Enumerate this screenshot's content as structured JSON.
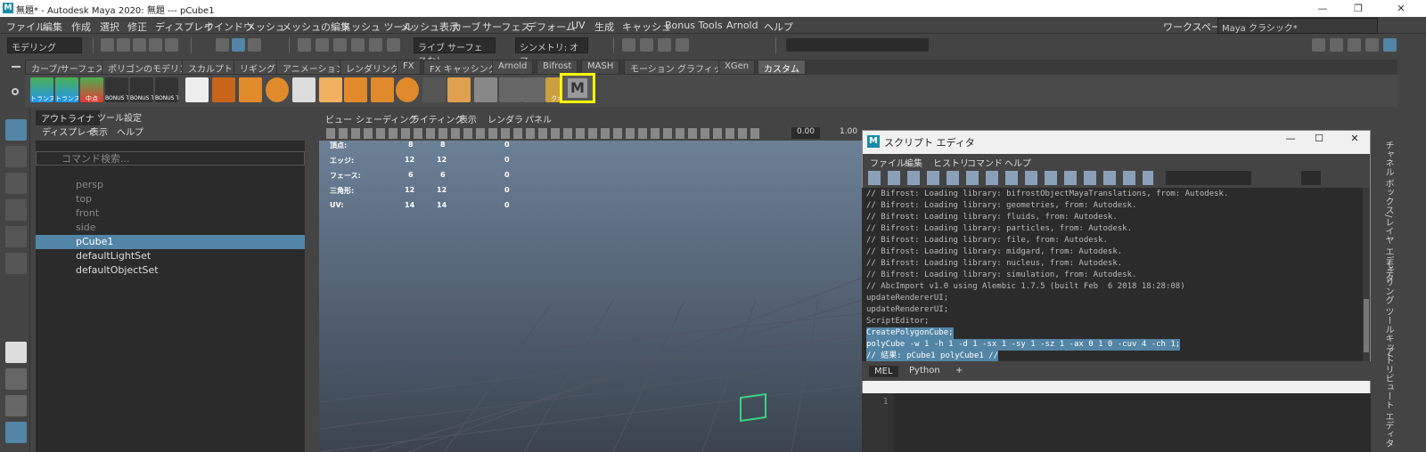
{
  "window": {
    "title": "無題* - Autodesk Maya 2020: 無題   ---   pCube1",
    "minimize_icon": "minimize-icon",
    "restore_label": "❐",
    "close_label": "✕"
  },
  "menus": [
    "ファイル",
    "編集",
    "作成",
    "選択",
    "修正",
    "ディスプレイ",
    "ウインドウ",
    "メッシュ",
    "メッシュの編集",
    "メッシュ ツール",
    "メッシュ表示",
    "カーブ",
    "サーフェス",
    "デフォーム",
    "UV",
    "生成",
    "キャッシュ",
    "Bonus Tools",
    "Arnold",
    "ヘルプ"
  ],
  "workspace": {
    "label": "ワークスペース:",
    "value": "Maya クラシック*"
  },
  "status": {
    "mode": "モデリング",
    "live_surface": "ライブ サーフェスなし",
    "symmetry": "シンメトリ: オフ"
  },
  "shelf_tabs": [
    "カーブ/サーフェス",
    "ポリゴンのモデリング",
    "スカルプト",
    "リギング",
    "アニメーション",
    "レンダリング",
    "FX",
    "FX キャッシング",
    "Arnold",
    "Bifrost",
    "MASH",
    "モーション グラフィックス",
    "XGen",
    "カスタム"
  ],
  "shelf_active": "カスタム",
  "shelf_labels": {
    "trans1": "トランス",
    "trans2": "トランス",
    "center": "中点",
    "bonus_vd": "BONUS TOOL VD",
    "bonus_el": "BONUS TOOL EL",
    "bonus_mpt": "BONUS TOOL MPtOa",
    "kuo": "クオ",
    "m": "M"
  },
  "outliner": {
    "tabs": [
      "アウトライナ",
      "ツール設定"
    ],
    "menu": [
      "ディスプレイ",
      "表示",
      "ヘルプ"
    ],
    "search_placeholder": "コマンド検索...",
    "items": [
      "persp",
      "top",
      "front",
      "side",
      "pCube1",
      "defaultLightSet",
      "defaultObjectSet"
    ],
    "selected": "pCube1"
  },
  "viewport": {
    "menu": [
      "ビュー",
      "シェーディング",
      "ライティング",
      "表示",
      "レンダラ",
      "パネル"
    ],
    "val1": "0.00",
    "val2": "1.00",
    "hud": [
      {
        "label": "頂点:",
        "a": "8",
        "b": "8",
        "c": "0"
      },
      {
        "label": "エッジ:",
        "a": "12",
        "b": "12",
        "c": "0"
      },
      {
        "label": "フェース:",
        "a": "6",
        "b": "6",
        "c": "0"
      },
      {
        "label": "三角形:",
        "a": "12",
        "b": "12",
        "c": "0"
      },
      {
        "label": "UV:",
        "a": "14",
        "b": "14",
        "c": "0"
      }
    ]
  },
  "script_editor": {
    "title": "スクリプト エディタ",
    "menu": [
      "ファイル",
      "編集",
      "ヒストリ",
      "コマンド",
      "ヘルプ"
    ],
    "log": [
      "// Bifrost: Loading library: bifrostObjectMayaTranslations, from: Autodesk.",
      "// Bifrost: Loading library: geometries, from: Autodesk.",
      "// Bifrost: Loading library: fluids, from: Autodesk.",
      "// Bifrost: Loading library: particles, from: Autodesk.",
      "// Bifrost: Loading library: file, from: Autodesk.",
      "// Bifrost: Loading library: midgard, from: Autodesk.",
      "// Bifrost: Loading library: nucleus, from: Autodesk.",
      "// Bifrost: Loading library: simulation, from: Autodesk.",
      "// AbcImport v1.0 using Alembic 1.7.5 (built Feb  6 2018 18:28:08)",
      "updateRendererUI;",
      "updateRendererUI;",
      "ScriptEditor;",
      "CreatePolygonCube;",
      "polyCube -w 1 -h 1 -d 1 -sx 1 -sy 1 -sz 1 -ax 0 1 0 -cuv 4 -ch 1;",
      "// 結果: pCube1 polyCube1 //"
    ],
    "selected_from": 12,
    "tabs": [
      "MEL",
      "Python",
      "+"
    ],
    "line_no": "1"
  },
  "right_panel": [
    "チャネル ボックス/レイヤ エディタ",
    "モデリング ツールキット",
    "アトリビュート エディタ"
  ],
  "colors": {
    "highlight": "#ffff00",
    "selection": "#5285a6",
    "outliner_selected": "#5285a6"
  }
}
